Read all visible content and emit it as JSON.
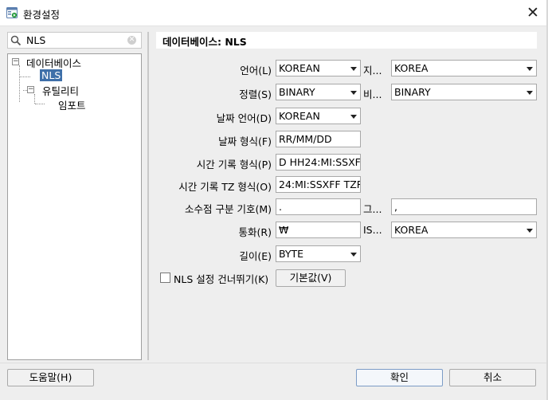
{
  "window": {
    "title": "환경설정",
    "close_glyph": "✕"
  },
  "search": {
    "value": "NLS",
    "clear_glyph": "✕"
  },
  "tree": {
    "items": [
      {
        "label": "데이터베이스",
        "expander": "−"
      },
      {
        "label": "NLS"
      },
      {
        "label": "유틸리티",
        "expander": "−"
      },
      {
        "label": "임포트"
      }
    ]
  },
  "panel": {
    "title": "데이터베이스: NLS"
  },
  "fields": {
    "language": {
      "label": "언어(L)",
      "value": "KOREAN"
    },
    "territory": {
      "label": "지...",
      "value": "KOREA"
    },
    "sort": {
      "label": "정렬(S)",
      "value": "BINARY"
    },
    "comparison": {
      "label": "비...",
      "value": "BINARY"
    },
    "date_language": {
      "label": "날짜 언어(D)",
      "value": "KOREAN"
    },
    "date_format": {
      "label": "날짜 형식(F)",
      "value": "RR/MM/DD"
    },
    "timestamp_format": {
      "label": "시간 기록 형식(P)",
      "value": "D HH24:MI:SSXFF"
    },
    "timestamp_tz_format": {
      "label": "시간 기록 TZ 형식(O)",
      "value": "24:MI:SSXFF TZR"
    },
    "decimal_separator": {
      "label": "소수점 구분 기호(M)",
      "value": "."
    },
    "group_separator": {
      "label": "그...",
      "value": ","
    },
    "currency": {
      "label": "통화(R)",
      "value": "₩"
    },
    "iso_currency": {
      "label": "IS...",
      "value": "KOREA"
    },
    "length": {
      "label": "길이(E)",
      "value": "BYTE"
    }
  },
  "skip_nls": {
    "label": "NLS 설정 건너뛰기(K)",
    "checked": false
  },
  "buttons": {
    "defaults": "기본값(V)",
    "help": "도움말(H)",
    "ok": "확인",
    "cancel": "취소"
  }
}
